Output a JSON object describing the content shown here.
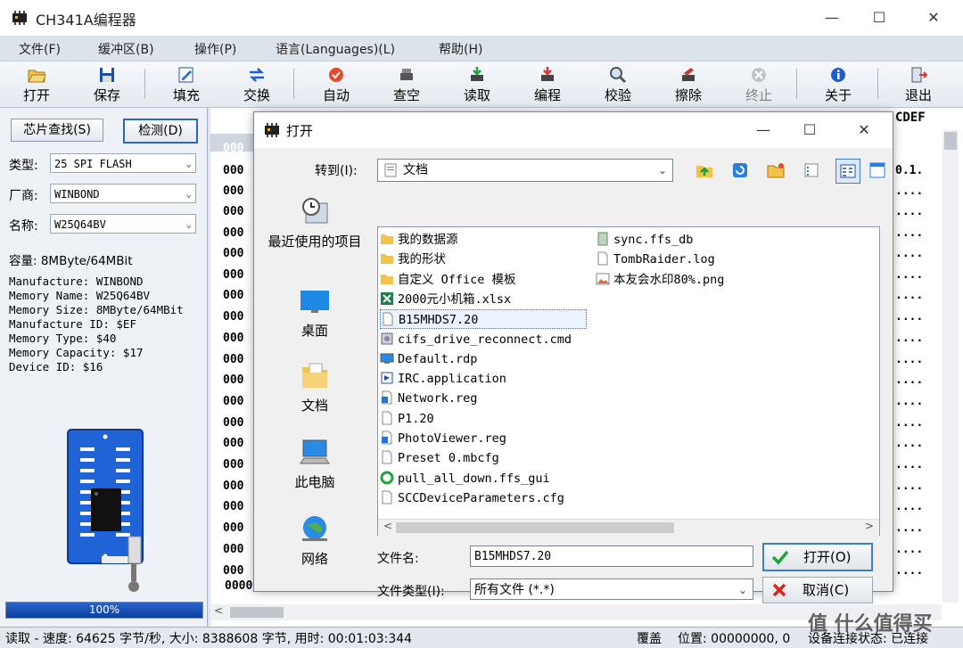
{
  "app": {
    "title": "CH341A编程器"
  },
  "menu": [
    "文件(F)",
    "缓冲区(B)",
    "操作(P)",
    "语言(Languages)(L)",
    "帮助(H)"
  ],
  "toolbar": [
    {
      "label": "打开",
      "icon": "open-folder-icon",
      "enabled": true
    },
    {
      "label": "保存",
      "icon": "save-disk-icon",
      "enabled": true
    },
    {
      "label": "填充",
      "icon": "fill-edit-icon",
      "enabled": true
    },
    {
      "label": "交换",
      "icon": "swap-arrows-icon",
      "enabled": true
    },
    {
      "label": "自动",
      "icon": "auto-icon",
      "enabled": true
    },
    {
      "label": "查空",
      "icon": "blank-check-icon",
      "enabled": true
    },
    {
      "label": "读取",
      "icon": "read-chip-icon",
      "enabled": true
    },
    {
      "label": "编程",
      "icon": "program-chip-icon",
      "enabled": true
    },
    {
      "label": "校验",
      "icon": "verify-icon",
      "enabled": true
    },
    {
      "label": "擦除",
      "icon": "erase-icon",
      "enabled": true
    },
    {
      "label": "终止",
      "icon": "stop-icon",
      "enabled": false
    },
    {
      "label": "关于",
      "icon": "info-icon",
      "enabled": true
    },
    {
      "label": "退出",
      "icon": "exit-door-icon",
      "enabled": true
    }
  ],
  "left": {
    "chip_search": "芯片查找(S)",
    "detect": "检测(D)",
    "type_label": "类型:",
    "type_value": "25 SPI FLASH",
    "vendor_label": "厂商:",
    "vendor_value": "WINBOND",
    "name_label": "名称:",
    "name_value": "W25Q64BV",
    "capacity": "容量: 8MByte/64MBit",
    "info": [
      "Manufacture: WINBOND",
      "Memory Name: W25Q64BV",
      "Memory Size: 8MByte/64MBit",
      "Manufacture ID: $EF",
      "Memory Type: $40",
      "Memory Capacity: $17",
      "Device ID: $16"
    ],
    "progress_text": "100%",
    "progress_value": 1.0
  },
  "hex": {
    "header_right": "CDEF",
    "row_prefix": "000",
    "bottom_addr": "00000",
    "right_text_2": "0.1.",
    "right_fill": "...."
  },
  "status": {
    "left": "读取 - 速度: 64625 字节/秒, 大小: 8388608 字节, 用时: 00:01:03:344",
    "mode": "覆盖",
    "position": "位置: 00000000, 0",
    "device": "设备连接状态: 已连接"
  },
  "dialog": {
    "title": "打开",
    "goto_label": "转到(I):",
    "goto_value": "文档",
    "nav": [
      {
        "label": "最近使用的项目",
        "icon": "recent-items-icon"
      },
      {
        "label": "桌面",
        "icon": "desktop-icon"
      },
      {
        "label": "文档",
        "icon": "documents-folder-icon"
      },
      {
        "label": "此电脑",
        "icon": "this-pc-icon"
      },
      {
        "label": "网络",
        "icon": "network-globe-icon"
      }
    ],
    "files_col1": [
      {
        "name": "我的数据源",
        "type": "folder"
      },
      {
        "name": "我的形状",
        "type": "folder"
      },
      {
        "name": "自定义 Office 模板",
        "type": "folder"
      },
      {
        "name": "2000元小机箱.xlsx",
        "type": "excel"
      },
      {
        "name": "B15MHDS7.20",
        "type": "file"
      },
      {
        "name": "cifs_drive_reconnect.cmd",
        "type": "cmd"
      },
      {
        "name": "Default.rdp",
        "type": "rdp"
      },
      {
        "name": "IRC.application",
        "type": "app"
      },
      {
        "name": "Network.reg",
        "type": "reg"
      },
      {
        "name": "P1.20",
        "type": "file"
      },
      {
        "name": "PhotoViewer.reg",
        "type": "reg"
      },
      {
        "name": "Preset 0.mbcfg",
        "type": "file"
      },
      {
        "name": "pull_all_down.ffs_gui",
        "type": "sync"
      },
      {
        "name": "SCCDeviceParameters.cfg",
        "type": "file"
      }
    ],
    "files_col2": [
      {
        "name": "sync.ffs_db",
        "type": "db"
      },
      {
        "name": "TombRaider.log",
        "type": "file"
      },
      {
        "name": "本友会水印80%.png",
        "type": "image"
      }
    ],
    "selected_file": "B15MHDS7.20",
    "filename_label": "文件名:",
    "filename_value": "B15MHDS7.20",
    "filetype_label": "文件类型(I):",
    "filetype_value": "所有文件 (*.*)",
    "open_button": "打开(O)",
    "cancel_button": "取消(C)"
  },
  "watermark": "值 什么值得买",
  "colors": {
    "accent": "#1b4fbd",
    "chip_board": "#1f63d6",
    "folder": "#f3c249"
  }
}
